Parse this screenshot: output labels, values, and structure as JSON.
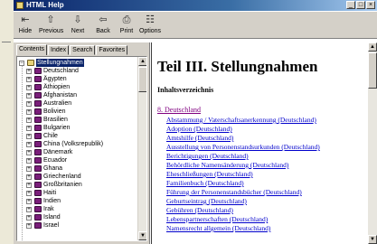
{
  "window": {
    "title": "HTML Help"
  },
  "toolbar": {
    "buttons": [
      {
        "label": "Hide",
        "icon": "hide-icon",
        "glyph": "⇤"
      },
      {
        "label": "Previous",
        "icon": "up-arrow-icon",
        "glyph": "⇧"
      },
      {
        "label": "Next",
        "icon": "down-arrow-icon",
        "glyph": "⇩"
      },
      {
        "label": "Back",
        "icon": "back-arrow-icon",
        "glyph": "⇦"
      },
      {
        "label": "Print",
        "icon": "printer-icon",
        "glyph": "⎙"
      },
      {
        "label": "Options",
        "icon": "options-icon",
        "glyph": "☷"
      }
    ]
  },
  "nav": {
    "tabs": [
      {
        "label": "Contents",
        "active": true
      },
      {
        "label": "Index",
        "active": false
      },
      {
        "label": "Search",
        "active": false
      },
      {
        "label": "Favorites",
        "active": false
      }
    ],
    "root": "Stellungnahmen",
    "items": [
      "Deutschland",
      "Ägypten",
      "Äthiopien",
      "Afghanistan",
      "Australien",
      "Bolivien",
      "Brasilien",
      "Bulgarien",
      "Chile",
      "China (Volksrepublik)",
      "Dänemark",
      "Ecuador",
      "Ghana",
      "Griechenland",
      "Großbritanien",
      "Haiti",
      "Indien",
      "Irak",
      "Island",
      "Israel"
    ]
  },
  "content": {
    "title": "Teil III.  Stellungnahmen",
    "subtitle": "Inhaltsverzeichnis",
    "section": "8. Deutschland",
    "links": [
      "Abstammung / Vaterschaftsanerkennung (Deutschland)",
      "Adoption (Deutschland)",
      "Amtshilfe (Deutschland)",
      "Ausstellung von Personenstandsurkunden (Deutschland)",
      "Berichtigungen (Deutschland)",
      "Behördliche Namensänderung (Deutschland)",
      "Eheschließungen (Deutschland)",
      "Familienbuch (Deutschland)",
      "Führung der Personenstandsbücher (Deutschland)",
      "Geburtseintrag (Deutschland)",
      "Gebühren (Deutschland)",
      "Lebenspartnerschaften (Deutschland)",
      "Namensrecht allgemein (Deutschland)"
    ]
  },
  "colors": {
    "title_bar": "#0a246a",
    "selection": "#0a246a",
    "link": "#0000cc",
    "visited_link": "#800080",
    "book": "#7a1e7a"
  }
}
